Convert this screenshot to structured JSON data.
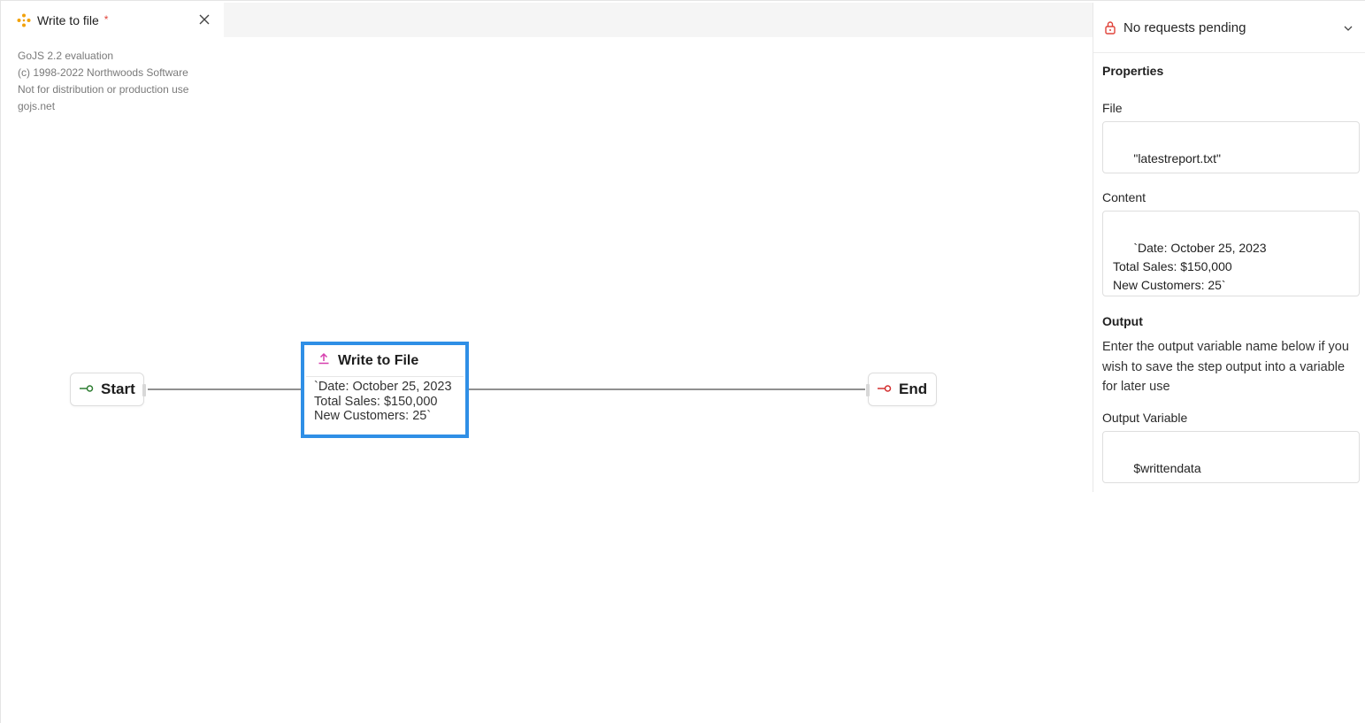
{
  "tab": {
    "title": "Write to file",
    "dirty_marker": "*",
    "icon": "workflow-icon",
    "close_icon": "close-icon"
  },
  "watermark": {
    "lines": [
      "GoJS 2.2 evaluation",
      "(c) 1998-2022 Northwoods Software",
      "Not for distribution or production use",
      "gojs.net"
    ]
  },
  "diagram": {
    "start": {
      "label": "Start",
      "icon": "start-port-icon",
      "color": "#2e7d32"
    },
    "end": {
      "label": "End",
      "icon": "end-port-icon",
      "color": "#d32f2f"
    },
    "step": {
      "title": "Write to File",
      "icon": "upload-icon",
      "icon_color": "#d63fae",
      "border_color": "#2f8fe6",
      "content_lines": [
        "`Date: October 25, 2023",
        "Total Sales: $150,000",
        "New Customers: 25`"
      ]
    }
  },
  "panel": {
    "requests": {
      "label": "No requests pending",
      "icon": "lock-icon",
      "icon_color": "#e0433a"
    },
    "properties_title": "Properties",
    "file": {
      "label": "File",
      "value": "\"latestreport.txt\""
    },
    "content": {
      "label": "Content",
      "value": "`Date: October 25, 2023\nTotal Sales: $150,000\nNew Customers: 25`"
    },
    "output": {
      "title": "Output",
      "help": "Enter the output variable name below if you wish to save the step output into a variable for later use",
      "variable_label": "Output Variable",
      "variable_value": "$writtendata"
    }
  }
}
